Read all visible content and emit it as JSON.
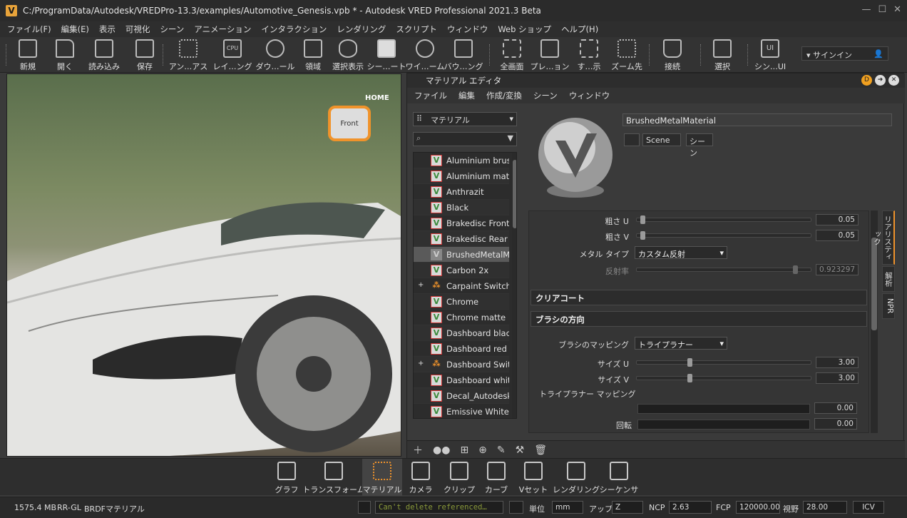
{
  "window": {
    "title": "C:/ProgramData/Autodesk/VREDPro-13.3/examples/Automotive_Genesis.vpb * - Autodesk VRED Professional 2021.3 Beta",
    "controls": [
      "—",
      "☐",
      "✕"
    ]
  },
  "menubar": [
    "ファイル(F)",
    "編集(E)",
    "表示",
    "可視化",
    "シーン",
    "アニメーション",
    "インタラクション",
    "レンダリング",
    "スクリプト",
    "ウィンドウ",
    "Web ショップ",
    "ヘルプ(H)"
  ],
  "toolbar": {
    "buttons": [
      "新規",
      "開く",
      "読み込み",
      "保存",
      "アン…アス",
      "レイ…ング",
      "ダウ…ール",
      "領域",
      "選択表示",
      "シー…ート",
      "ワイ…ーム",
      "バウ…ング",
      "全画面",
      "プレ…ョン",
      "す…示",
      "ズーム先",
      "接続",
      "選択",
      "シン…UI"
    ],
    "cpu_label": "CPU",
    "ui_label": "UI",
    "signin": "サインイン"
  },
  "viewport": {
    "home_label": "HOME",
    "navcube_label": "Front"
  },
  "material_editor": {
    "title": "マテリアル エディタ",
    "menu": [
      "ファイル",
      "編集",
      "作成/変換",
      "シーン",
      "ウィンドウ"
    ],
    "material_dropdown": "マテリアル",
    "materials": [
      {
        "name": "Aluminium brushed",
        "type": "plain"
      },
      {
        "name": "Aluminium matte",
        "type": "plain"
      },
      {
        "name": "Anthrazit",
        "type": "plain"
      },
      {
        "name": "Black",
        "type": "plain"
      },
      {
        "name": "Brakedisc Front",
        "type": "plain"
      },
      {
        "name": "Brakedisc Rear",
        "type": "plain"
      },
      {
        "name": "BrushedMetalMaterial",
        "type": "selected"
      },
      {
        "name": "Carbon 2x",
        "type": "plain"
      },
      {
        "name": "Carpaint Switch",
        "type": "switch"
      },
      {
        "name": "Chrome",
        "type": "plain"
      },
      {
        "name": "Chrome matte",
        "type": "plain"
      },
      {
        "name": "Dashboard black",
        "type": "plain"
      },
      {
        "name": "Dashboard red",
        "type": "plain"
      },
      {
        "name": "Dashboard Switch",
        "type": "switch"
      },
      {
        "name": "Dashboard white",
        "type": "plain"
      },
      {
        "name": "Decal_Autodesk",
        "type": "plain"
      },
      {
        "name": "Emissive White C",
        "type": "plain"
      }
    ],
    "material_name": "BrushedMetalMaterial",
    "scene_dropdown": "Scene",
    "scene_button": "シーン",
    "properties": {
      "roughness_u": {
        "label": "粗さ U",
        "value": "0.05",
        "level": 0.02
      },
      "roughness_v": {
        "label": "粗さ V",
        "value": "0.05",
        "level": 0.02
      },
      "metal_type": {
        "label": "メタル タイプ",
        "value": "カスタム反射"
      },
      "reflectivity": {
        "label": "反射率",
        "value": "0.923297",
        "level": 0.92
      },
      "clearcoat_section": "クリアコート",
      "brush_section": "ブラシの方向",
      "brush_mapping": {
        "label": "ブラシのマッピング",
        "value": "トライプラナー"
      },
      "size_u": {
        "label": "サイズ U",
        "value": "3.00",
        "level": 0.3
      },
      "size_v": {
        "label": "サイズ V",
        "value": "3.00",
        "level": 0.3
      },
      "triplanar_label": "トライプラナー マッピング",
      "triplanar_value": "0.00",
      "rotation": {
        "label": "回転",
        "value": "0.00"
      }
    },
    "side_tabs": [
      "リアリスティック",
      "解析",
      "NPR"
    ]
  },
  "modules": [
    "グラフ",
    "トランスフォーム",
    "マテリアル",
    "カメラ",
    "クリップ",
    "カーブ",
    "Vセット",
    "レンダリング",
    "シーケンサ"
  ],
  "status": {
    "memory": "1575.4 MB",
    "renderer": "RR-GL",
    "mode": "BRDFマテリアル",
    "message": "Can't delete referenced…",
    "unit_label": "単位",
    "unit_value": "mm",
    "up_label": "アップ",
    "up_value": "Z",
    "ncp_label": "NCP",
    "ncp_value": "2.63",
    "fcp_label": "FCP",
    "fcp_value": "120000.00",
    "fov_label": "視野",
    "fov_value": "28.00",
    "icv": "ICV"
  },
  "colors": {
    "accent": "#f0932b",
    "bg": "#3a3a3a"
  }
}
